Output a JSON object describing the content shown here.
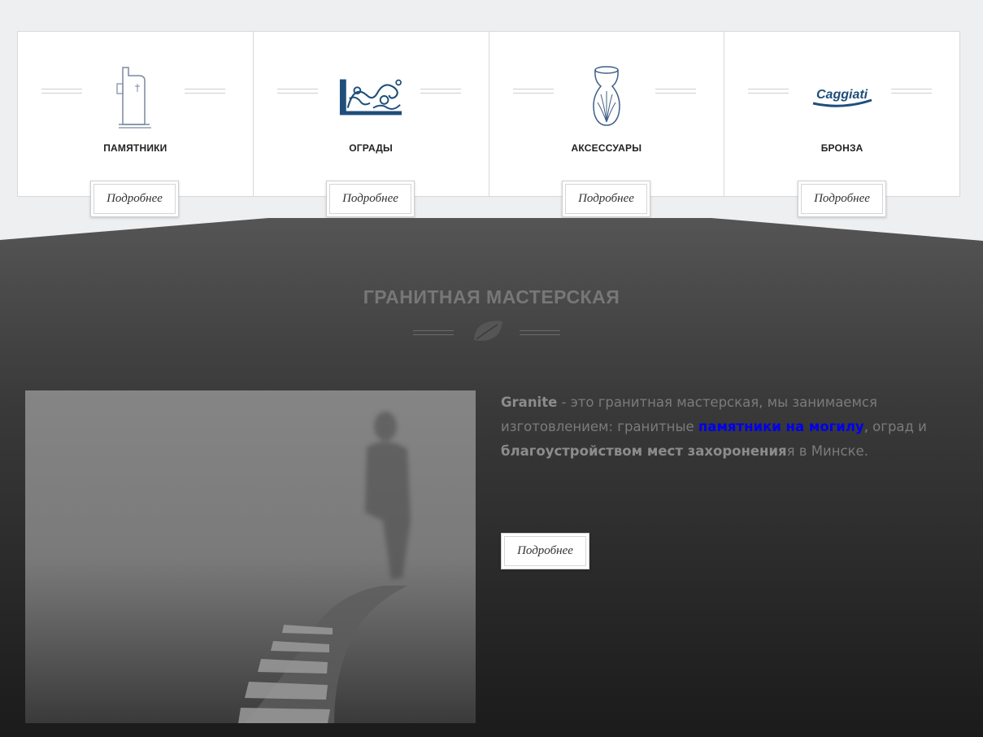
{
  "cards": [
    {
      "label": "ПАМЯТНИКИ",
      "icon": "monument-icon",
      "button": "Подробнее"
    },
    {
      "label": "ОГРАДЫ",
      "icon": "fence-icon",
      "button": "Подробнее"
    },
    {
      "label": "АКСЕССУАРЫ",
      "icon": "vase-icon",
      "button": "Подробнее"
    },
    {
      "label": "БРОНЗА",
      "icon": "caggiati-logo",
      "logo_text": "Caggiati",
      "button": "Подробнее"
    }
  ],
  "workshop": {
    "title": "ГРАНИТНАЯ МАСТЕРСКАЯ",
    "title_icon": "leaf-icon",
    "brand": "Granite",
    "text_1": " - это гранитная мастерская, мы занимаемся изготовлением: гранитные ",
    "link": "памятники на могилу",
    "text_2": ", оград и ",
    "bold": "благоустройством мест захоронения",
    "text_3": "я в Минске.",
    "button": "Подробнее"
  },
  "colors": {
    "page_bg": "#eeeff1",
    "dark_top": "#555555",
    "dark_bottom": "#1c1c1c",
    "icon_blue": "#1f4e7a",
    "link": "#0000ee"
  }
}
